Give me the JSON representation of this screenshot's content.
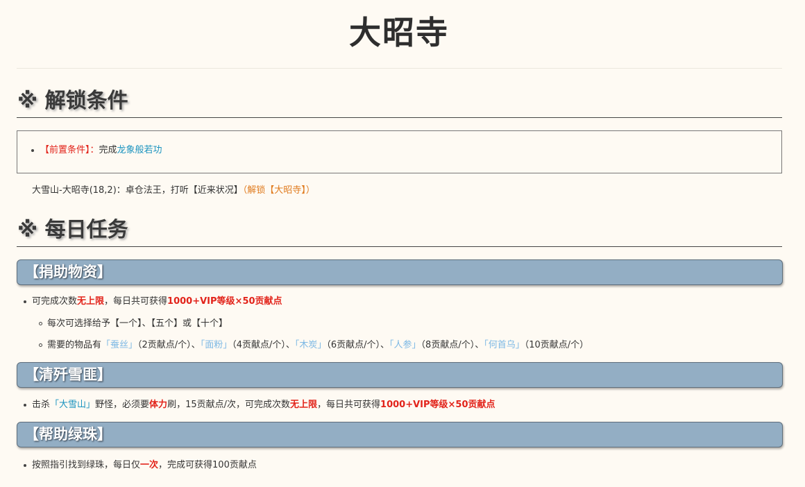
{
  "page": {
    "title": "大昭寺"
  },
  "unlock": {
    "heading": "※ 解锁条件",
    "prereq_label": "【前置条件】：",
    "prereq_text": "完成",
    "prereq_link": "龙象般若功",
    "location_text": "大雪山-大昭寺(18,2)：卓仓法王，打听【近来状况】",
    "location_note": "（解锁【大昭寺】）"
  },
  "daily": {
    "heading": "※ 每日任务",
    "donate": {
      "title": "【捐助物资】",
      "line1": {
        "a": "可完成次数",
        "b": "无上限",
        "c": "，每日共可获得",
        "d": "1000+VIP等级×50贡献点"
      },
      "line2": "每次可选择给予【一个】、【五个】或【十个】",
      "line3": {
        "intro": "需要的物品有",
        "items": [
          {
            "name": "「蚕丝」",
            "note": "（2贡献点/个）、"
          },
          {
            "name": "「面粉」",
            "note": "（4贡献点/个）、"
          },
          {
            "name": "「木炭」",
            "note": "（6贡献点/个）、"
          },
          {
            "name": "「人参」",
            "note": "（8贡献点/个）、"
          },
          {
            "name": "「何首乌」",
            "note": "（10贡献点/个）"
          }
        ]
      }
    },
    "bandit": {
      "title": "【清歼雪匪】",
      "line": {
        "a": "击杀",
        "b": "「大雪山」",
        "c": "野怪，必须要",
        "d": "体力",
        "e": "刷，15贡献点/次，可完成次数",
        "f": "无上限",
        "g": "，每日共可获得",
        "h": "1000+VIP等级×50贡献点"
      }
    },
    "help": {
      "title": "【帮助绿珠】",
      "line": {
        "a": "按照指引找到绿珠，每日仅",
        "b": "一次",
        "c": "，完成可获得100贡献点"
      }
    }
  },
  "colors": {
    "background": "#fefaf3",
    "band": "#93aec4",
    "highlight_red": "#e2231a",
    "link_teal": "#1a93bf",
    "item_blue": "#7cb8e4",
    "note_orange": "#e07b1e"
  }
}
